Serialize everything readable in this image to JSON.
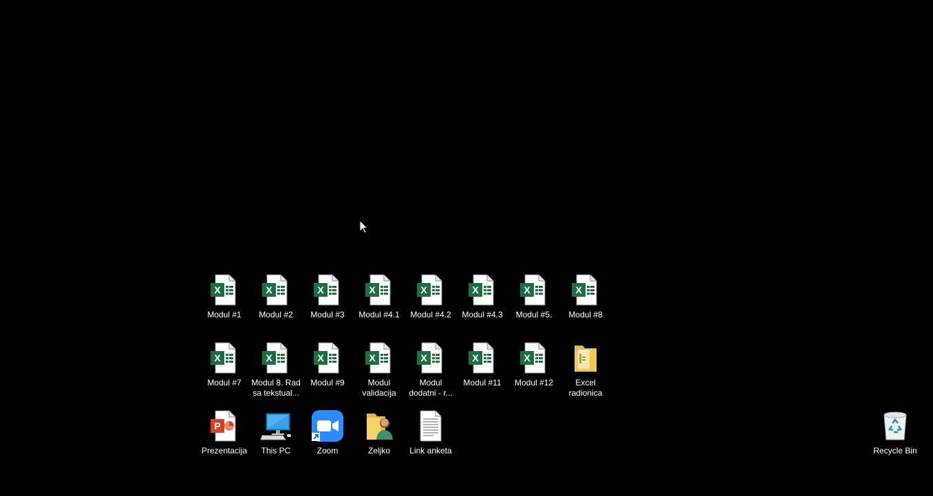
{
  "desktop": {
    "icons": [
      {
        "label": "Modul #1",
        "type": "excel-file-icon"
      },
      {
        "label": "Modul #2",
        "type": "excel-file-icon"
      },
      {
        "label": "Modul #3",
        "type": "excel-file-icon"
      },
      {
        "label": "Modul #4.1",
        "type": "excel-file-icon"
      },
      {
        "label": "Modul #4.2",
        "type": "excel-file-icon"
      },
      {
        "label": "Modul #4.3",
        "type": "excel-file-icon"
      },
      {
        "label": "Modul #5.",
        "type": "excel-file-icon"
      },
      {
        "label": "Modul #8",
        "type": "excel-file-icon"
      },
      {
        "label": "Modul #7",
        "type": "excel-file-icon"
      },
      {
        "label": "Modul 8. Rad sa tekstual...",
        "type": "excel-file-icon"
      },
      {
        "label": "Modul #9",
        "type": "excel-file-icon"
      },
      {
        "label": "Modul validacija",
        "type": "excel-file-icon"
      },
      {
        "label": "Modul dodatni - r...",
        "type": "excel-file-icon"
      },
      {
        "label": "Modul #11",
        "type": "excel-file-icon"
      },
      {
        "label": "Modul #12",
        "type": "excel-file-icon"
      },
      {
        "label": "Excel radionica",
        "type": "folder-icon"
      },
      {
        "label": "Prezentacija",
        "type": "powerpoint-file-icon"
      },
      {
        "label": "This PC",
        "type": "computer-icon"
      },
      {
        "label": "Zoom",
        "type": "zoom-app-icon"
      },
      {
        "label": "Zeljko",
        "type": "user-folder-icon"
      },
      {
        "label": "Link anketa",
        "type": "text-document-icon"
      },
      {
        "label": "Recycle Bin",
        "type": "recycle-bin-icon"
      }
    ]
  },
  "colors": {
    "background": "#000000",
    "excel_green": "#1D6F42",
    "powerpoint_red": "#D04423",
    "zoom_blue": "#2D8CFF",
    "folder_yellow": "#F2C94C",
    "label_text": "#FFFFFF"
  }
}
